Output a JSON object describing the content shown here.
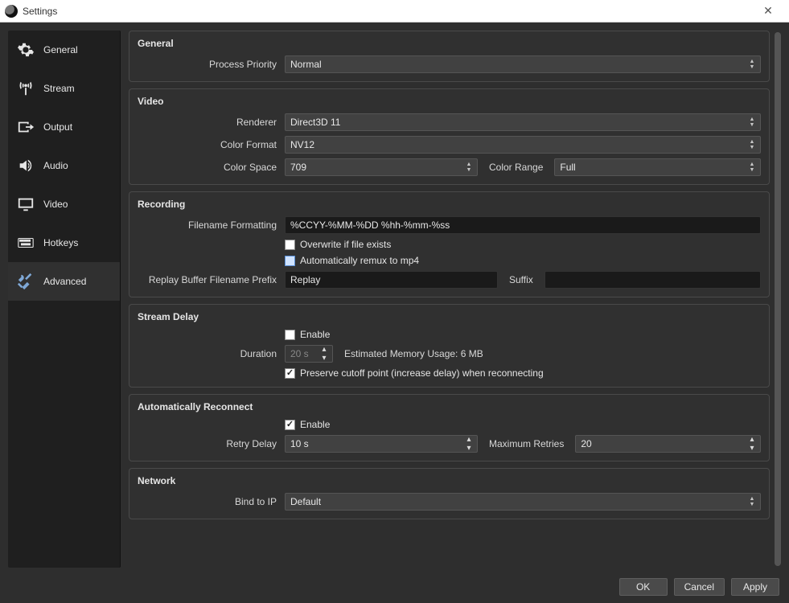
{
  "window": {
    "title": "Settings"
  },
  "sidebar": {
    "items": [
      {
        "label": "General",
        "icon": "gear-icon"
      },
      {
        "label": "Stream",
        "icon": "antenna-icon"
      },
      {
        "label": "Output",
        "icon": "output-icon"
      },
      {
        "label": "Audio",
        "icon": "speaker-icon"
      },
      {
        "label": "Video",
        "icon": "monitor-icon"
      },
      {
        "label": "Hotkeys",
        "icon": "keyboard-icon"
      },
      {
        "label": "Advanced",
        "icon": "tools-icon"
      }
    ],
    "selected": 6
  },
  "general": {
    "title": "General",
    "process_priority_label": "Process Priority",
    "process_priority": "Normal"
  },
  "video": {
    "title": "Video",
    "renderer_label": "Renderer",
    "renderer": "Direct3D 11",
    "color_format_label": "Color Format",
    "color_format": "NV12",
    "color_space_label": "Color Space",
    "color_space": "709",
    "color_range_label": "Color Range",
    "color_range": "Full"
  },
  "recording": {
    "title": "Recording",
    "filename_formatting_label": "Filename Formatting",
    "filename_formatting": "%CCYY-%MM-%DD %hh-%mm-%ss",
    "overwrite_label": "Overwrite if file exists",
    "overwrite": false,
    "remux_label": "Automatically remux to mp4",
    "remux": false,
    "replay_prefix_label": "Replay Buffer Filename Prefix",
    "replay_prefix": "Replay",
    "suffix_label": "Suffix",
    "suffix": ""
  },
  "stream_delay": {
    "title": "Stream Delay",
    "enable_label": "Enable",
    "enable": false,
    "duration_label": "Duration",
    "duration": "20 s",
    "estimated_label": "Estimated Memory Usage: 6 MB",
    "preserve_label": "Preserve cutoff point (increase delay) when reconnecting",
    "preserve": true
  },
  "reconnect": {
    "title": "Automatically Reconnect",
    "enable_label": "Enable",
    "enable": true,
    "retry_delay_label": "Retry Delay",
    "retry_delay": "10 s",
    "max_retries_label": "Maximum Retries",
    "max_retries": "20"
  },
  "network": {
    "title": "Network",
    "bind_label": "Bind to IP",
    "bind": "Default"
  },
  "buttons": {
    "ok": "OK",
    "cancel": "Cancel",
    "apply": "Apply"
  }
}
